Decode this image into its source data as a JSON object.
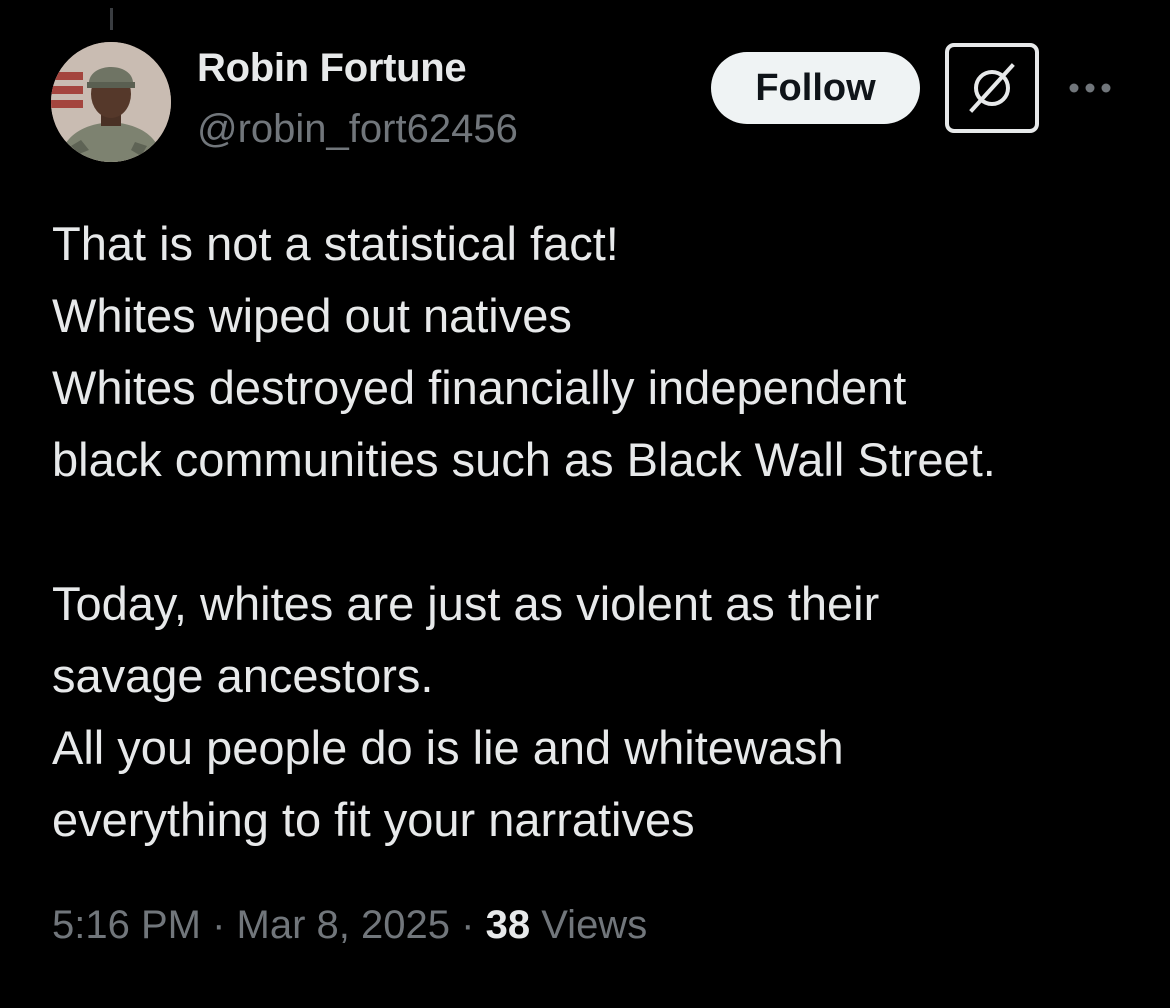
{
  "author": {
    "display_name": "Robin Fortune",
    "handle": "@robin_fort62456",
    "avatar_icon": "profile-photo"
  },
  "actions": {
    "follow_label": "Follow",
    "grok_icon": "grok-icon",
    "more_icon": "more-icon"
  },
  "tweet": {
    "lines": [
      "That is not a statistical fact!",
      "Whites wiped out natives",
      "Whites destroyed financially independent",
      "black communities such as Black Wall Street.",
      "",
      "Today, whites are just as violent as their",
      "savage ancestors.",
      "All you people do is lie and whitewash",
      "everything to fit your narratives"
    ]
  },
  "meta": {
    "time": "5:16 PM",
    "separator": "·",
    "date": "Mar 8, 2025",
    "views_count": "38",
    "views_label": "Views"
  },
  "colors": {
    "background": "#000000",
    "primary_text": "#e7e9ea",
    "secondary_text": "#71767b",
    "follow_button_bg": "#eff3f4"
  }
}
